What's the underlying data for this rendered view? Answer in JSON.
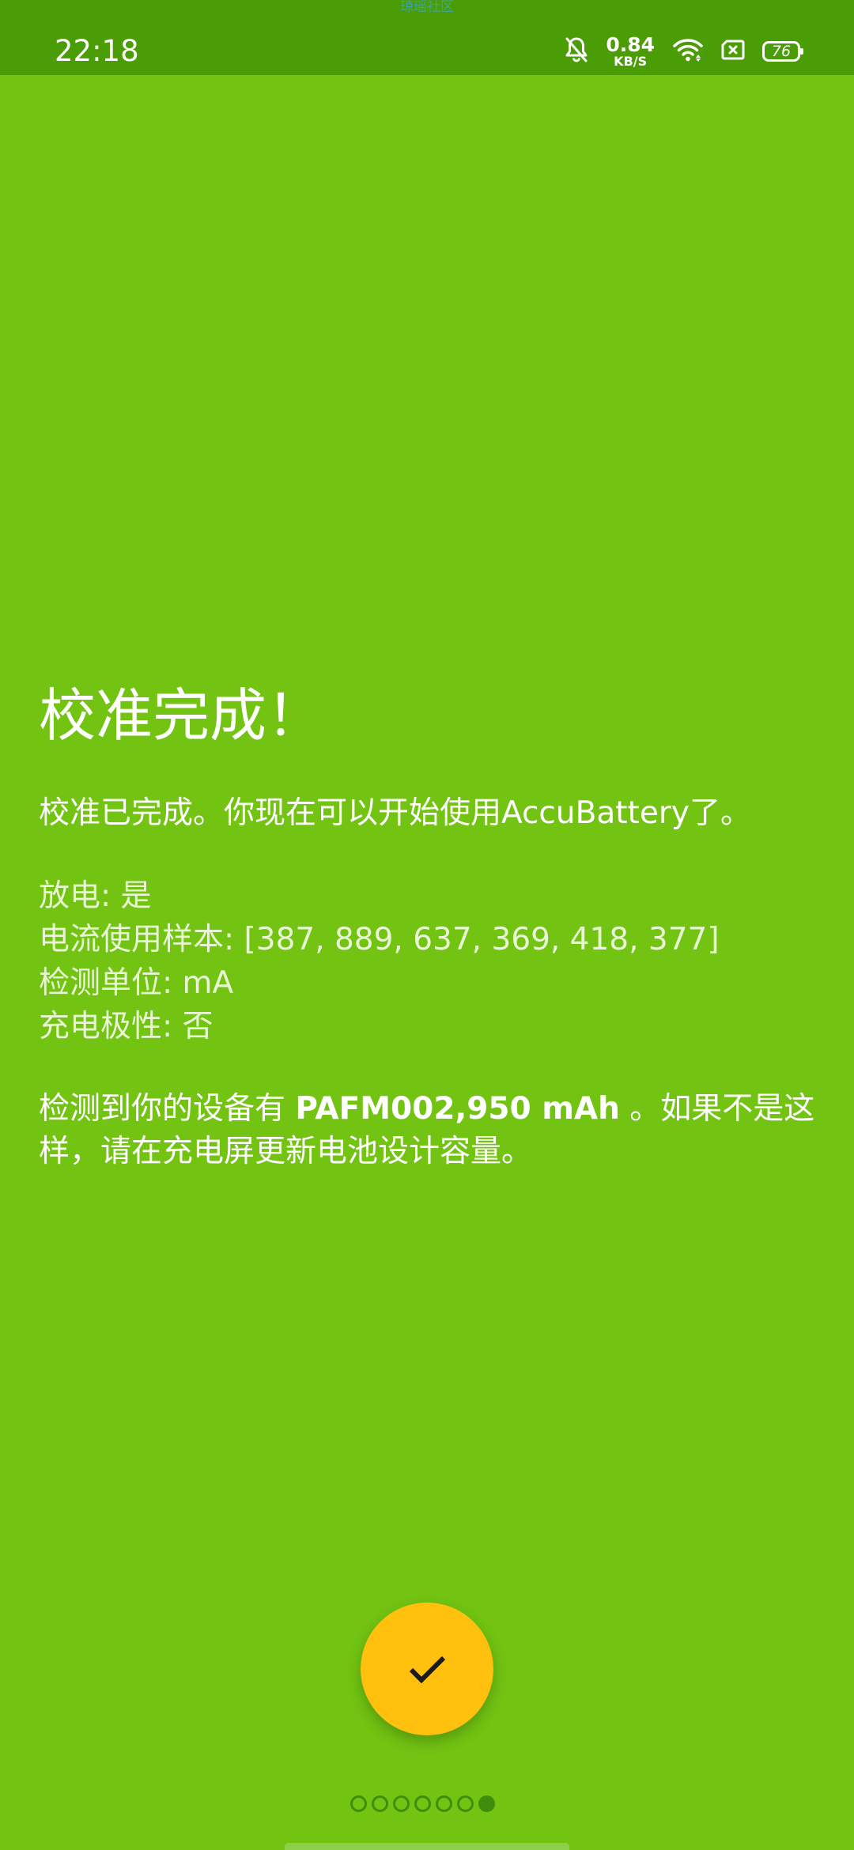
{
  "status_bar": {
    "watermark": "琼瑶社区",
    "time": "22:18",
    "net_speed": "0.84",
    "net_speed_unit": "KB/S",
    "battery": "76",
    "icons": [
      "bell-muted-icon",
      "wifi-icon",
      "sim-absent-icon",
      "battery-icon"
    ]
  },
  "content": {
    "title": "校准完成！",
    "intro": "校准已完成。你现在可以开始使用AccuBattery了。",
    "details": [
      "放电: 是",
      "电流使用样本: [387, 889, 637, 369, 418, 377]",
      "检测单位: mA",
      "充电极性: 否"
    ],
    "result_prefix": "检测到你的设备有 ",
    "result_bold": "PAFM002,950 mAh",
    "result_suffix": " 。如果不是这样，请在充电屏更新电池设计容量。"
  },
  "fab": {
    "icon": "check-icon",
    "color": "#ffc10e"
  },
  "pager": {
    "total": 7,
    "current": 7
  },
  "colors": {
    "background": "#72c312",
    "status_bar": "#4a9d05",
    "accent": "#ffc10e",
    "dot": "#3f8d0a"
  }
}
